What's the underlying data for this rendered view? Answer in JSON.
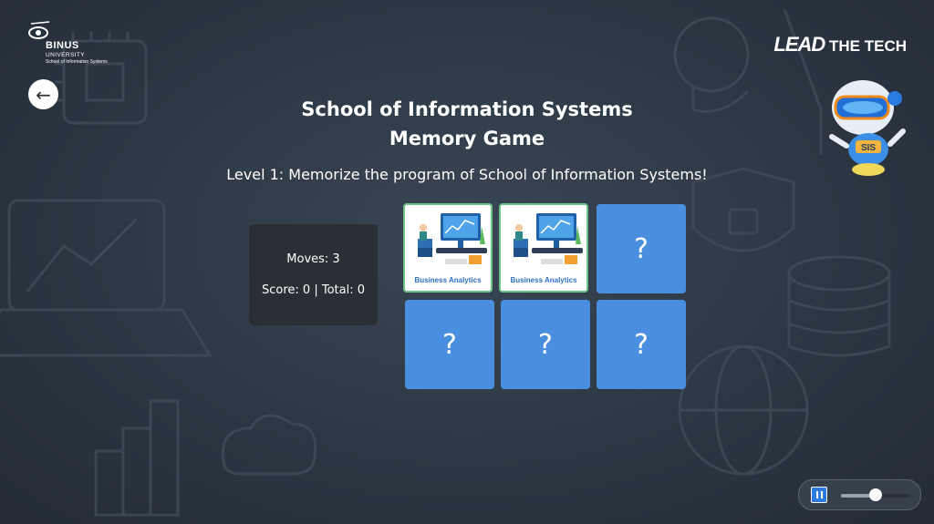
{
  "logo": {
    "brand": "BINUS",
    "university": "UNIVERSITY",
    "school": "School of Information Systems"
  },
  "header": {
    "tagline_lead": "LEAD",
    "tagline_rest": "THE TECH",
    "back_icon": "←"
  },
  "game": {
    "title_line1": "School of Information Systems",
    "title_line2": "Memory Game",
    "level_text": "Level 1: Memorize the program of School of Information Systems!"
  },
  "stats": {
    "moves": "Moves: 3",
    "score": "Score: 0 | Total: 0"
  },
  "cards": [
    {
      "state": "revealed",
      "label": "Business Analytics"
    },
    {
      "state": "revealed",
      "label": "Business Analytics"
    },
    {
      "state": "hidden",
      "label": "?"
    },
    {
      "state": "hidden",
      "label": "?"
    },
    {
      "state": "hidden",
      "label": "?"
    },
    {
      "state": "hidden",
      "label": "?"
    }
  ],
  "mascot": {
    "badge": "SIS"
  },
  "audio": {
    "state": "paused",
    "volume": 0.5
  },
  "colors": {
    "card_hidden": "#4a8fdf",
    "card_border": "#6cc489",
    "player_button": "#2c7be0"
  }
}
